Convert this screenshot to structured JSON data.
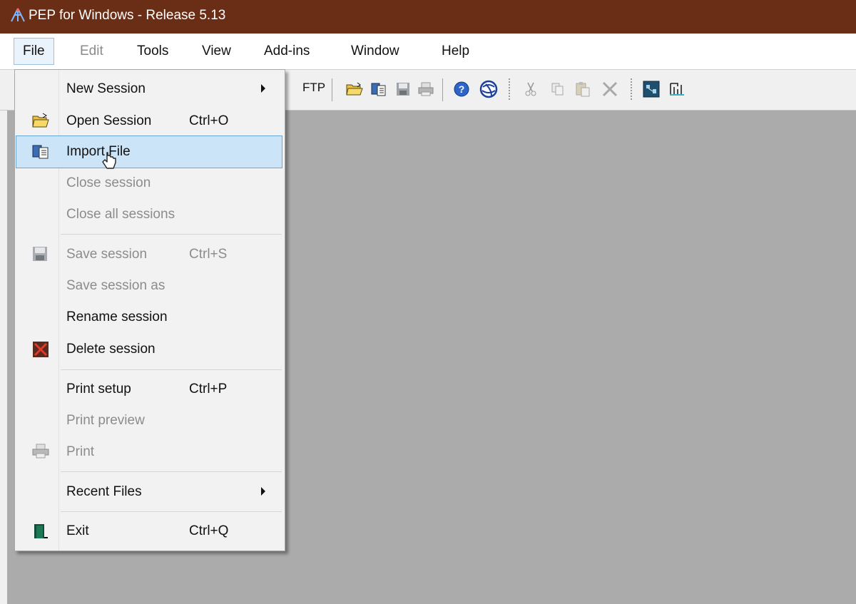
{
  "window": {
    "title": "PEP for Windows - Release 5.13"
  },
  "menubar": {
    "items": [
      {
        "label": "File",
        "state": "open"
      },
      {
        "label": "Edit",
        "state": "disabled"
      },
      {
        "label": "Tools"
      },
      {
        "label": "View"
      },
      {
        "label": "Add-ins"
      },
      {
        "label": "Window"
      },
      {
        "label": "Help"
      }
    ]
  },
  "toolbar": {
    "ftp_label": "FTP",
    "buttons": [
      "open-folder-icon",
      "import-icon",
      "save-icon",
      "print-icon",
      "help-icon",
      "globe-icon",
      "cut-icon",
      "copy-icon",
      "paste-icon",
      "delete-icon",
      "structure-icon",
      "chart-icon"
    ]
  },
  "file_menu": {
    "items": [
      {
        "label": "New Session",
        "shortcut": "",
        "submenu": true,
        "enabled": true,
        "icon": ""
      },
      {
        "label": "Open Session",
        "shortcut": "Ctrl+O",
        "enabled": true,
        "icon": "open-folder-icon"
      },
      {
        "label": "Import File",
        "shortcut": "",
        "enabled": true,
        "highlighted": true,
        "icon": "import-icon"
      },
      {
        "label": "Close session",
        "shortcut": "",
        "enabled": false,
        "icon": ""
      },
      {
        "label": "Close all sessions",
        "shortcut": "",
        "enabled": false,
        "icon": ""
      },
      {
        "label": "Save session",
        "shortcut": "Ctrl+S",
        "enabled": false,
        "icon": "save-icon"
      },
      {
        "label": "Save session as",
        "shortcut": "",
        "enabled": false,
        "icon": ""
      },
      {
        "label": "Rename session",
        "shortcut": "",
        "enabled": true,
        "icon": ""
      },
      {
        "label": "Delete session",
        "shortcut": "",
        "enabled": true,
        "icon": "delete-session-icon"
      },
      {
        "label": "Print setup",
        "shortcut": "Ctrl+P",
        "enabled": true,
        "icon": ""
      },
      {
        "label": "Print preview",
        "shortcut": "",
        "enabled": false,
        "icon": ""
      },
      {
        "label": "Print",
        "shortcut": "",
        "enabled": false,
        "icon": "print-icon"
      },
      {
        "label": "Recent Files",
        "shortcut": "",
        "submenu": true,
        "enabled": true,
        "icon": ""
      },
      {
        "label": "Exit",
        "shortcut": "Ctrl+Q",
        "enabled": true,
        "icon": "exit-door-icon"
      }
    ]
  },
  "colors": {
    "titlebar": "#6a2d15",
    "workspace": "#ababab",
    "highlight": "#cce4f7",
    "highlight_border": "#6aa7d6"
  }
}
